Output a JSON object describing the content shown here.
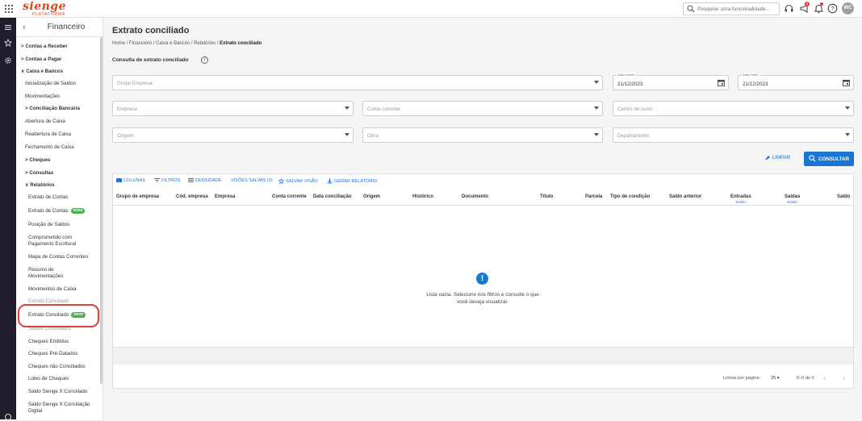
{
  "header": {
    "logo_text": "sienge",
    "logo_sub": "PLATAFORMA",
    "search_placeholder": "Pesquise uma funcionalidade...",
    "notif_count": "2",
    "avatar_initials": "WC"
  },
  "sidebar": {
    "title": "Financeiro",
    "items": [
      {
        "label": "Contas a Receber",
        "prefix": ">"
      },
      {
        "label": "Contas a Pagar",
        "prefix": ">"
      },
      {
        "label": "Caixa e Bancos",
        "prefix": "∨"
      },
      {
        "label": "Inicialização de Saldos"
      },
      {
        "label": "Movimentações"
      },
      {
        "label": "Conciliação Bancária",
        "prefix": ">"
      },
      {
        "label": "Abertura de Caixa"
      },
      {
        "label": "Reabertura de Caixa"
      },
      {
        "label": "Fechamento de Caixa"
      },
      {
        "label": "Cheques",
        "prefix": ">"
      },
      {
        "label": "Consultas",
        "prefix": ">"
      },
      {
        "label": "Relatórios",
        "prefix": "∨"
      },
      {
        "label": "Extrato de Contas"
      },
      {
        "label": "Extrato de Contas"
      },
      {
        "label": "Posição de Saldos"
      },
      {
        "label": "Comprometido com"
      },
      {
        "label": "Pagamento Escritural"
      },
      {
        "label": "Mapa de Contas Correntes"
      },
      {
        "label": "Resumo de"
      },
      {
        "label": "Movimentações"
      },
      {
        "label": "Movimentos de Caixa"
      },
      {
        "label": "Extrato Conciliado"
      },
      {
        "label": "Extrato Conciliado"
      },
      {
        "label": "Saldos Conciliados"
      },
      {
        "label": "Cheques Emitidos"
      },
      {
        "label": "Cheques Pré-Datados"
      },
      {
        "label": "Cheques não Conciliados"
      },
      {
        "label": "Lotes de Cheques"
      },
      {
        "label": "Saldo Sienge X Conciliado"
      },
      {
        "label": "Saldo Sienge X Conciliação"
      },
      {
        "label": "Digital"
      }
    ],
    "novo_badge": "novo"
  },
  "main": {
    "title": "Extrato conciliado",
    "breadcrumb": [
      "Home",
      "Financeiro",
      "Caixa e Bancos",
      "Relatórios",
      "Extrato conciliado"
    ],
    "breadcrumb_sep": "/",
    "section_title": "Consulta de extrato conciliado",
    "filters": {
      "grupo_empresa": "Grupo Empresa",
      "data_inicial_label": "Data Inicial*",
      "data_inicial": "21/12/2023",
      "data_final_label": "Data Final*",
      "data_final": "21/12/2023",
      "empresa": "Empresa",
      "conta_corrente": "Conta corrente",
      "centro_custo": "Centro de custo",
      "origem": "Origem",
      "obra": "Obra",
      "departamento": "Departamento"
    },
    "btn_limpar": "LIMPAR",
    "btn_consultar": "CONSULTAR"
  },
  "grid": {
    "toolbar": [
      "COLUNAS",
      "FILTROS",
      "DENSIDADE",
      "VISÕES SALVAS (0)",
      "SALVAR VISÃO",
      "GERAR RELATÓRIO"
    ],
    "columns": [
      "Grupo de empresa",
      "Cód. empresa",
      "Empresa",
      "Conta corrente",
      "Data conciliação",
      "Origem",
      "Histórico",
      "Documento",
      "Título",
      "Parcela",
      "Tipo de condição",
      "Saldo anterior",
      "Entradas",
      "Saídas",
      "Saldo"
    ],
    "soma": "SOMA",
    "empty_line1": "Lista vazia. Selecione nos filtros e consulte o que",
    "empty_line2": "você deseja visualizar.",
    "rows_per_page_label": "Linhas por página:",
    "rows_per_page": "25",
    "range": "0–0 de 0"
  }
}
